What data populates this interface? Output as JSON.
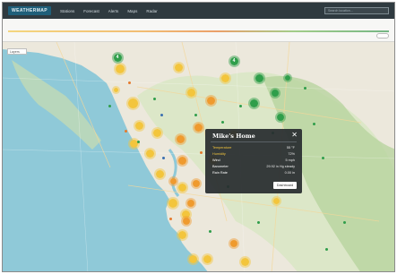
{
  "app": {
    "brand": "WEATHERMAP",
    "nav_items": [
      "Stations",
      "Forecast",
      "Alerts",
      "Maps",
      "Radar"
    ],
    "search_placeholder": "Search location..."
  },
  "timeline": {
    "start_label": "",
    "end_label": ""
  },
  "map": {
    "layer_button_label": "Layers"
  },
  "markers": {
    "yellow": [
      "",
      "",
      "",
      "",
      "",
      "",
      "",
      "",
      "",
      "",
      "",
      "",
      "",
      "",
      "",
      "",
      "",
      "",
      "",
      "",
      ""
    ],
    "orange": [
      "",
      "",
      "",
      "",
      "",
      "",
      "",
      "",
      ""
    ],
    "green": [
      "4",
      "4",
      "",
      "",
      "",
      "",
      ""
    ]
  },
  "popup": {
    "title": "Mike's Home",
    "close_glyph": "✕",
    "rows": [
      {
        "label": "Temperature",
        "value": "55 °F",
        "color": "#f3c53c"
      },
      {
        "label": "Humidity",
        "value": "72%",
        "color": "#f3c53c"
      },
      {
        "label": "Wind",
        "value": "5 mph",
        "color": "#ffffff"
      },
      {
        "label": "Barometer",
        "value": "29.92 in Hg steady",
        "color": "#ffffff"
      },
      {
        "label": "Rain Rate",
        "value": "0.00 in",
        "color": "#ffffff"
      }
    ],
    "button_label": "Dashboard"
  },
  "colors": {
    "ocean": "#8fc9d8",
    "land": "#ece8dc",
    "forest": "#bcd7a6",
    "popup_bg": "#282c2f",
    "marker_yellow": "#f3c53c",
    "marker_orange": "#ef9a2e",
    "marker_green": "#2f9e4a"
  }
}
